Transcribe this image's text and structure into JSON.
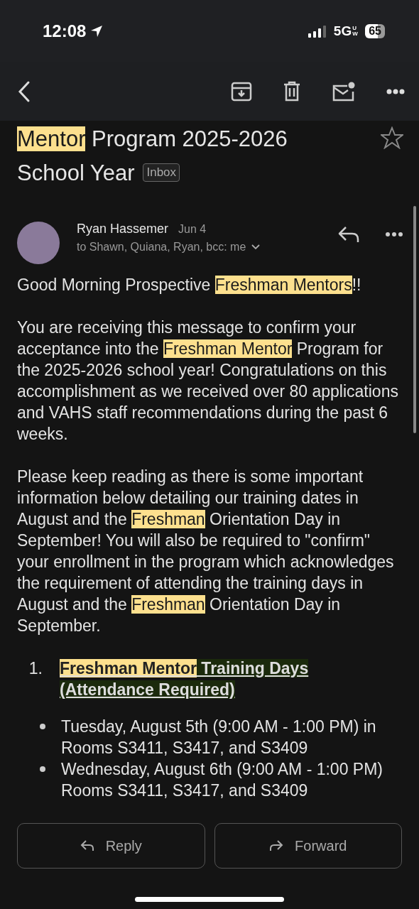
{
  "status_bar": {
    "time": "12:08",
    "network": "5G",
    "network_sub": "UW",
    "battery": "65"
  },
  "subject": {
    "segments": [
      {
        "text": "Mentor",
        "highlight": true
      },
      {
        "text": " Program 2025-2026 School Year",
        "highlight": false
      }
    ],
    "label": "Inbox",
    "starred": false
  },
  "message": {
    "sender": "Ryan Hassemer",
    "date": "Jun 4",
    "recipients": "to Shawn, Quiana, Ryan, bcc: me"
  },
  "body": [
    {
      "kind": "paragraph",
      "segments": [
        {
          "text": "Good Morning Prospective ",
          "highlight": false
        },
        {
          "text": "Freshman Mentors",
          "highlight": true
        },
        {
          "text": "!!",
          "highlight": false
        }
      ]
    },
    {
      "kind": "paragraph",
      "segments": [
        {
          "text": "You are receiving this message to confirm your acceptance into the ",
          "highlight": false
        },
        {
          "text": "Freshman Mentor",
          "highlight": true
        },
        {
          "text": " Program for the 2025-2026 school year! Congratulations on this accomplishment as we received over 80 applications and VAHS staff recommendations during the past 6 weeks.",
          "highlight": false
        }
      ]
    },
    {
      "kind": "paragraph",
      "segments": [
        {
          "text": "Please keep reading as there is some important information below detailing our training dates in August and the ",
          "highlight": false
        },
        {
          "text": "Freshman",
          "highlight": true
        },
        {
          "text": " Orientation Day in September! You will also be required to \"confirm\" your enrollment in the program which acknowledges the requirement of attending the training days in August and the ",
          "highlight": false
        },
        {
          "text": "Freshman",
          "highlight": true
        },
        {
          "text": " Orientation Day in September.",
          "highlight": false
        }
      ]
    },
    {
      "kind": "numbered",
      "number": "1.",
      "segments": [
        {
          "text": "Freshman Mentor",
          "highlight": true
        },
        {
          "text": " Training Days (Attendance Required)",
          "highlight": false
        }
      ]
    },
    {
      "kind": "bullet",
      "text": "Tuesday, August 5th (9:00 AM - 1:00 PM) in Rooms S3411, S3417, and S3409"
    },
    {
      "kind": "bullet",
      "text": "Wednesday, August 6th (9:00 AM - 1:00 PM) Rooms S3411, S3417, and S3409"
    }
  ],
  "buttons": [
    "Reply",
    "Forward"
  ]
}
